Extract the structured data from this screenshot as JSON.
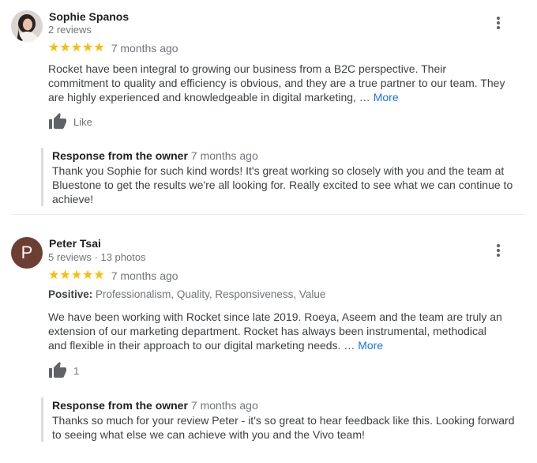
{
  "reviews": [
    {
      "name": "Sophie Spanos",
      "meta": "2 reviews",
      "stars": "★★★★★",
      "rating": 5,
      "date": "7 months ago",
      "text": "Rocket have been integral to growing our business from a B2C perspective. Their commitment to quality and efficiency is obvious, and they are a true partner to our team. They are highly experienced and knowledgeable in digital marketing, …",
      "more": "More",
      "like_label": "Like",
      "response": {
        "label": "Response from the owner",
        "date": "7 months ago",
        "text": "Thank you Sophie for such kind words! It's great working so closely with you and the team at Bluestone to get the results we're all looking for. Really excited to see what we can continue to achieve!"
      }
    },
    {
      "name": "Peter Tsai",
      "initial": "P",
      "meta": "5 reviews · 13 photos",
      "stars": "★★★★★",
      "rating": 5,
      "date": "7 months ago",
      "positive_label": "Positive:",
      "positive_values": "Professionalism, Quality, Responsiveness, Value",
      "text": "We have been working with Rocket since late 2019. Roeya, Aseem and the team are truly an extension of our marketing department. Rocket has always been instrumental, methodical and flexible in their approach to our digital marketing needs. …",
      "more": "More",
      "like_label": "1",
      "response": {
        "label": "Response from the owner",
        "date": "7 months ago",
        "text": "Thanks so much for your review Peter - it's so great to hear feedback like this. Looking forward to seeing what else we can achieve with you and the Vivo team!"
      }
    }
  ],
  "colors": {
    "star": "#fbbc04",
    "link": "#1a73e8",
    "avatar_p": "#6d3f33"
  },
  "icons": [
    "more-vert-icon",
    "thumbs-up-icon",
    "star-icon"
  ]
}
